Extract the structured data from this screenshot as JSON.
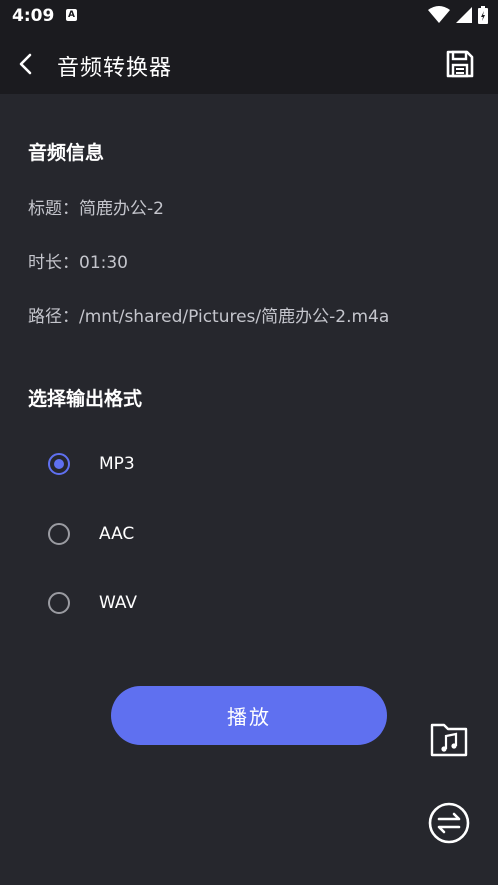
{
  "status_bar": {
    "time": "4:09",
    "notification_badge": "A"
  },
  "app_bar": {
    "title": "音频转换器"
  },
  "audio_info": {
    "section_title": "音频信息",
    "title_line": "标题：简鹿办公-2",
    "duration_line": "时长：01:30",
    "path_line": "路径：/mnt/shared/Pictures/简鹿办公-2.m4a"
  },
  "output_format": {
    "section_title": "选择输出格式",
    "options": [
      {
        "label": "MP3",
        "selected": true
      },
      {
        "label": "AAC",
        "selected": false
      },
      {
        "label": "WAV",
        "selected": false
      }
    ]
  },
  "actions": {
    "play_label": "播放"
  },
  "icons": {
    "back": "arrow-left-icon",
    "save": "save-icon",
    "music_folder": "music-folder-icon",
    "convert": "swap-arrows-icon",
    "wifi": "wifi-icon",
    "signal": "cell-signal-icon",
    "battery": "battery-icon"
  },
  "colors": {
    "background": "#26272d",
    "bar_background": "#1b1b1f",
    "accent": "#5f70f0",
    "secondary_text": "#c4c5cc"
  }
}
